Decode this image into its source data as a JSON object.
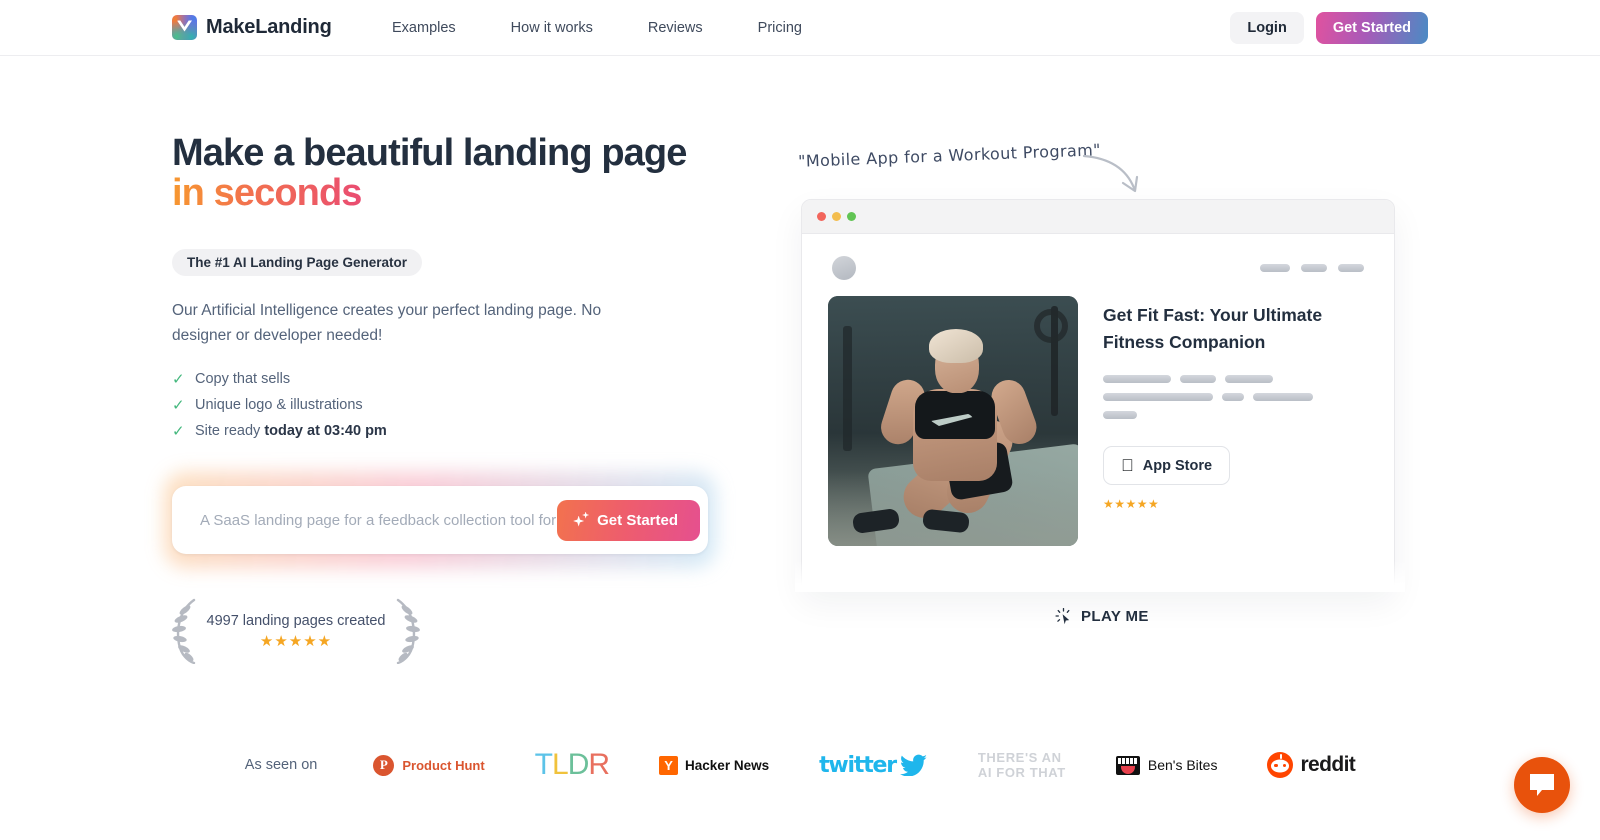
{
  "header": {
    "brand": "MakeLanding",
    "logo_icon": "makelanding-logo-icon",
    "nav": [
      {
        "label": "Examples"
      },
      {
        "label": "How it works"
      },
      {
        "label": "Reviews"
      },
      {
        "label": "Pricing"
      }
    ],
    "login_label": "Login",
    "get_started_label": "Get Started",
    "get_started_gradient": [
      "#e0529f",
      "#4a8bc4"
    ]
  },
  "hero": {
    "headline_line1": "Make a beautiful landing page",
    "headline_line2": "in seconds",
    "headline_gradient": [
      "#f7982f",
      "#ea4c72"
    ],
    "badge": "The #1 AI Landing Page Generator",
    "subtext": "Our Artificial Intelligence creates your perfect landing page. No designer or developer needed!",
    "features": [
      {
        "check": "✓",
        "text": "Copy that sells",
        "bold": ""
      },
      {
        "check": "✓",
        "text": "Unique logo & illustrations",
        "bold": ""
      },
      {
        "check": "✓",
        "text": "Site ready ",
        "bold": "today at 03:40 pm"
      }
    ],
    "prompt_placeholder": "A SaaS landing page for a feedback collection tool for",
    "prompt_value": "",
    "prompt_button_label": "Get Started",
    "prompt_button_icon": "sparkles-icon",
    "social_proof_count": "4997 landing pages created",
    "social_proof_stars": "★★★★★",
    "star_color": "#f5a623"
  },
  "preview": {
    "annotation": "\"Mobile App for a Workout Program\"",
    "window_dots": [
      "#f2655c",
      "#f3bd4e",
      "#61c454"
    ],
    "mock_title": "Get Fit Fast: Your Ultimate Fitness Companion",
    "app_store_label": "App Store",
    "app_store_icon": "apple-icon",
    "mock_stars": "★★★★★",
    "image_alt": "woman doing sit-ups in gym",
    "nav_placeholders": [
      30,
      26,
      26
    ],
    "text_placeholders": [
      [
        68,
        36,
        48
      ],
      [
        110,
        22,
        60
      ],
      [
        34
      ]
    ],
    "play_me_label": "PLAY ME",
    "play_me_icon": "click-cursor-icon"
  },
  "seen_on": {
    "label": "As seen on",
    "logos": [
      {
        "name": "Product Hunt",
        "mark": "P",
        "color": "#da552f"
      },
      {
        "name": "TLDR",
        "letters": [
          "T",
          "L",
          "D",
          "R"
        ],
        "colors": [
          "#5cc3e8",
          "#f0c23c",
          "#6cc09a",
          "#e8705f"
        ]
      },
      {
        "name": "Hacker News",
        "mark": "Y",
        "color": "#ff6600"
      },
      {
        "name": "twitter",
        "color": "#1fb6ec"
      },
      {
        "name": "THERE'S AN AI FOR THAT",
        "line1": "THERE'S AN",
        "line2": "AI FOR THAT",
        "color": "#cfd2d7"
      },
      {
        "name": "Ben's Bites",
        "color": "#111111"
      },
      {
        "name": "reddit",
        "color": "#ff4500"
      }
    ]
  },
  "chat": {
    "icon": "chat-bubble-icon",
    "color": "#e8520c"
  }
}
